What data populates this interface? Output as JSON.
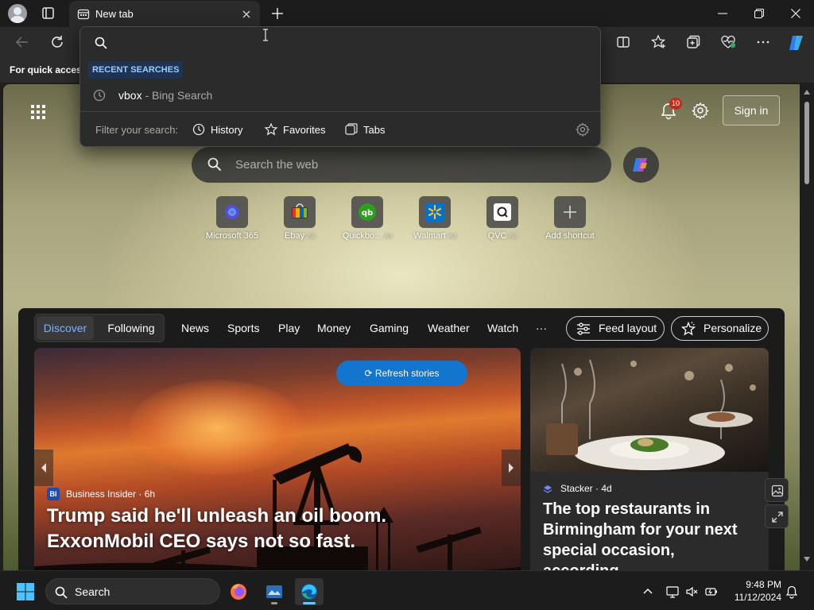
{
  "tab": {
    "title": "New tab"
  },
  "favorites_bar": {
    "text": "For quick access"
  },
  "omnibox": {
    "heading": "RECENT SEARCHES",
    "recent": [
      {
        "query": "vbox",
        "suffix": " - Bing Search"
      }
    ],
    "filter_label": "Filter your search:",
    "filters": [
      "History",
      "Favorites",
      "Tabs"
    ]
  },
  "ntp": {
    "notification_count": "10",
    "sign_in": "Sign in",
    "search_placeholder": "Search the web",
    "tiles": [
      {
        "label": "Microsoft 365",
        "ad": "",
        "icon": "microsoft-365-icon"
      },
      {
        "label": "Ebay",
        "ad": "Ad",
        "icon": "ebay-icon"
      },
      {
        "label": "Quickbo...",
        "ad": "Ad",
        "icon": "quickbooks-icon"
      },
      {
        "label": "Walmart",
        "ad": "Ad",
        "icon": "walmart-icon"
      },
      {
        "label": "QVC",
        "ad": "Ad",
        "icon": "qvc-icon"
      },
      {
        "label": "Add shortcut",
        "ad": "",
        "icon": "plus-icon"
      }
    ]
  },
  "feed": {
    "segments": [
      "Discover",
      "Following"
    ],
    "nav": [
      "News",
      "Sports",
      "Play",
      "Money",
      "Gaming",
      "Weather",
      "Watch",
      "···"
    ],
    "feed_layout": "Feed layout",
    "personalize": "Personalize",
    "refresh": "Refresh stories",
    "hero": {
      "source": "Business Insider · 6h",
      "source_badge": "BI",
      "title": "Trump said he'll unleash an oil boom. ExxonMobil CEO says not so fast."
    },
    "card2": {
      "source": "Stacker · 4d",
      "title": "The top restaurants in Birmingham for your next special occasion, according..."
    }
  },
  "taskbar": {
    "search": "Search",
    "time": "9:48 PM",
    "date": "11/12/2024"
  },
  "colors": {
    "accent": "#1475cf",
    "discover_text": "#78b4ff",
    "badge": "#c42b1c",
    "taskbar_active": "#60cdff"
  }
}
